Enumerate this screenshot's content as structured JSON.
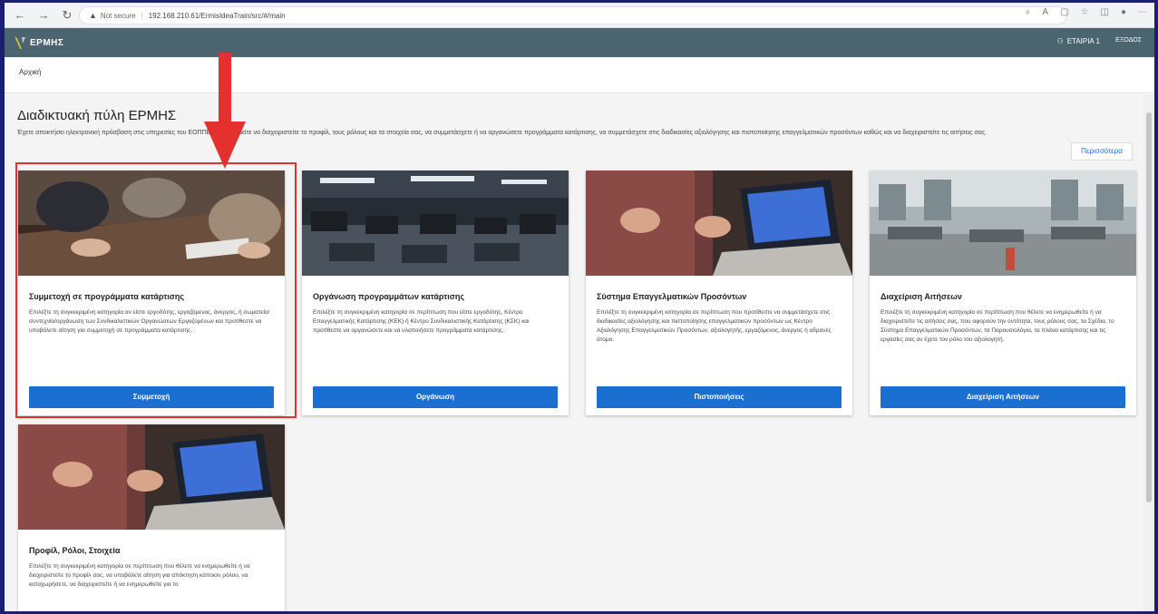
{
  "browser": {
    "security_label": "Not secure",
    "url": "192.168.210.61/ErmisIdeaTrain/src/#/main"
  },
  "header": {
    "logo_text": "ΕΡΜΗΣ",
    "user_label": "ΕΤΑΙΡΙΑ 1",
    "logout_label": "ΕΞΟΔΟΣ"
  },
  "breadcrumb": {
    "home": "Αρχική"
  },
  "page": {
    "title": "Διαδικτυακή πύλη ΕΡΜΗΣ",
    "description": "Έχετε αποκτήσει ηλεκτρονική πρόσβαση στις υπηρεσίες του ΕΟΠΠΕΠ και μπορείτε να διαχειριστείτε το προφίλ, τους ρόλους και τα στοιχεία σας, να συμμετάσχετε ή να οργανώσετε προγράμματα κατάρτισης, να συμμετάσχετε στις διαδικασίες αξιολόγησης και πιστοποίησης επαγγελματικών προσόντων καθώς και να διαχειριστείτε τις αιτήσεις σας.",
    "more_label": "Περισσότερα"
  },
  "cards": [
    {
      "title": "Συμμετοχή σε προγράμματα κατάρτισης",
      "description": "Επιλέξτε τη συγκεκριμένη κατηγορία αν είστε εργοδότης, εργαζόμενος, άνεργος, ή σωματείο/συντεχνία/οργάνωση των Συνδικαλιστικών Οργανώσεων Εργαζομένων και προτίθεστε να υποβάλετε αίτηση για συμμετοχή σε προγράμματα κατάρτισης.",
      "button": "Συμμετοχή"
    },
    {
      "title": "Οργάνωση προγραμμάτων κατάρτισης",
      "description": "Επιλέξτε τη συγκεκριμένη κατηγορία σε περίπτωση που είστε εργοδότης, Κέντρο Επαγγελματικής Κατάρτισης (ΚΕΚ) ή Κέντρο Συνδικαλιστικής Κατάρτισης (ΚΣΚ) και προτίθεστε να οργανώσετε και να υλοποιήσετε προγράμματα κατάρτισης.",
      "button": "Οργάνωση"
    },
    {
      "title": "Σύστημα Επαγγελματικών Προσόντων",
      "description": "Επιλέξτε τη συγκεκριμένη κατηγορία σε περίπτωση που προτίθεστε να συμμετάσχετε στις διαδικασίες αξιολόγησης και πιστοποίησης επαγγελματικών προσόντων ως Κέντρο Αξιολόγησης Επαγγελματικών Προσόντων, αξιολογητής, εργαζόμενος, άνεργος ή αδρανές άτομο.",
      "button": "Πιστοποιήσεις"
    },
    {
      "title": "Διαχείριση Αιτήσεων",
      "description": "Επιλέξτε τη συγκεκριμένη κατηγορία σε περίπτωση που θέλετε να ενημερωθείτε ή να διαχειριστείτε τις αιτήσεις σας, που αφορούν την οντότητα, τους ρόλους σας, τα Σχέδια, το Σύστημα Επαγγελματικών Προσόντων, τα Παρουσιολόγια, τα πλάνα κατάρτισης και τις εργασίες σας αν έχετε τον ρόλο του αξιολογητή.",
      "button": "Διαχείριση Αιτήσεων"
    },
    {
      "title": "Προφίλ, Ρόλοι, Στοιχεία",
      "description": "Επιλέξτε τη συγκεκριμένη κατηγορία σε περίπτωση που θέλετε να ενημερωθείτε ή να διαχειριστείτε το προφίλ σας, να υποβάλετε αίτηση για απόκτηση κάποιου ρόλου, να καταχωρήσετε, να διαχειριστείτε ή να ενημερωθείτε για το",
      "button": ""
    }
  ],
  "colors": {
    "header_bg": "#4a6470",
    "primary_button": "#1a6fd1",
    "highlight": "#e53030",
    "outer_bg": "#1a1f6e"
  }
}
